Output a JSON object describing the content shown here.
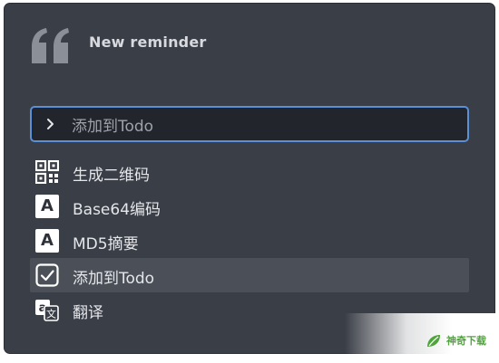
{
  "window": {
    "title": "New reminder",
    "title_icon": "quote-icon"
  },
  "search": {
    "value": "添加到Todo",
    "chevron_icon": "chevron-right-icon",
    "accent_color": "#5b8fd6"
  },
  "items": [
    {
      "label": "生成二维码",
      "icon": "qr-code-icon"
    },
    {
      "label": "Base64编码",
      "icon": "letter-a-icon"
    },
    {
      "label": "MD5摘要",
      "icon": "letter-a-icon"
    },
    {
      "label": "添加到Todo",
      "icon": "checkbox-icon",
      "selected": true
    },
    {
      "label": "翻译",
      "icon": "translate-icon"
    }
  ],
  "glyphs": {
    "letter_a": "A",
    "translate_latin": "a",
    "translate_cjk": "文"
  },
  "watermark": {
    "text": "神奇下载",
    "logo_icon": "leaf-logo-icon"
  },
  "colors": {
    "panel": "#3a3e46",
    "selected_row": "#4a4f58",
    "search_bg": "#22252b"
  }
}
